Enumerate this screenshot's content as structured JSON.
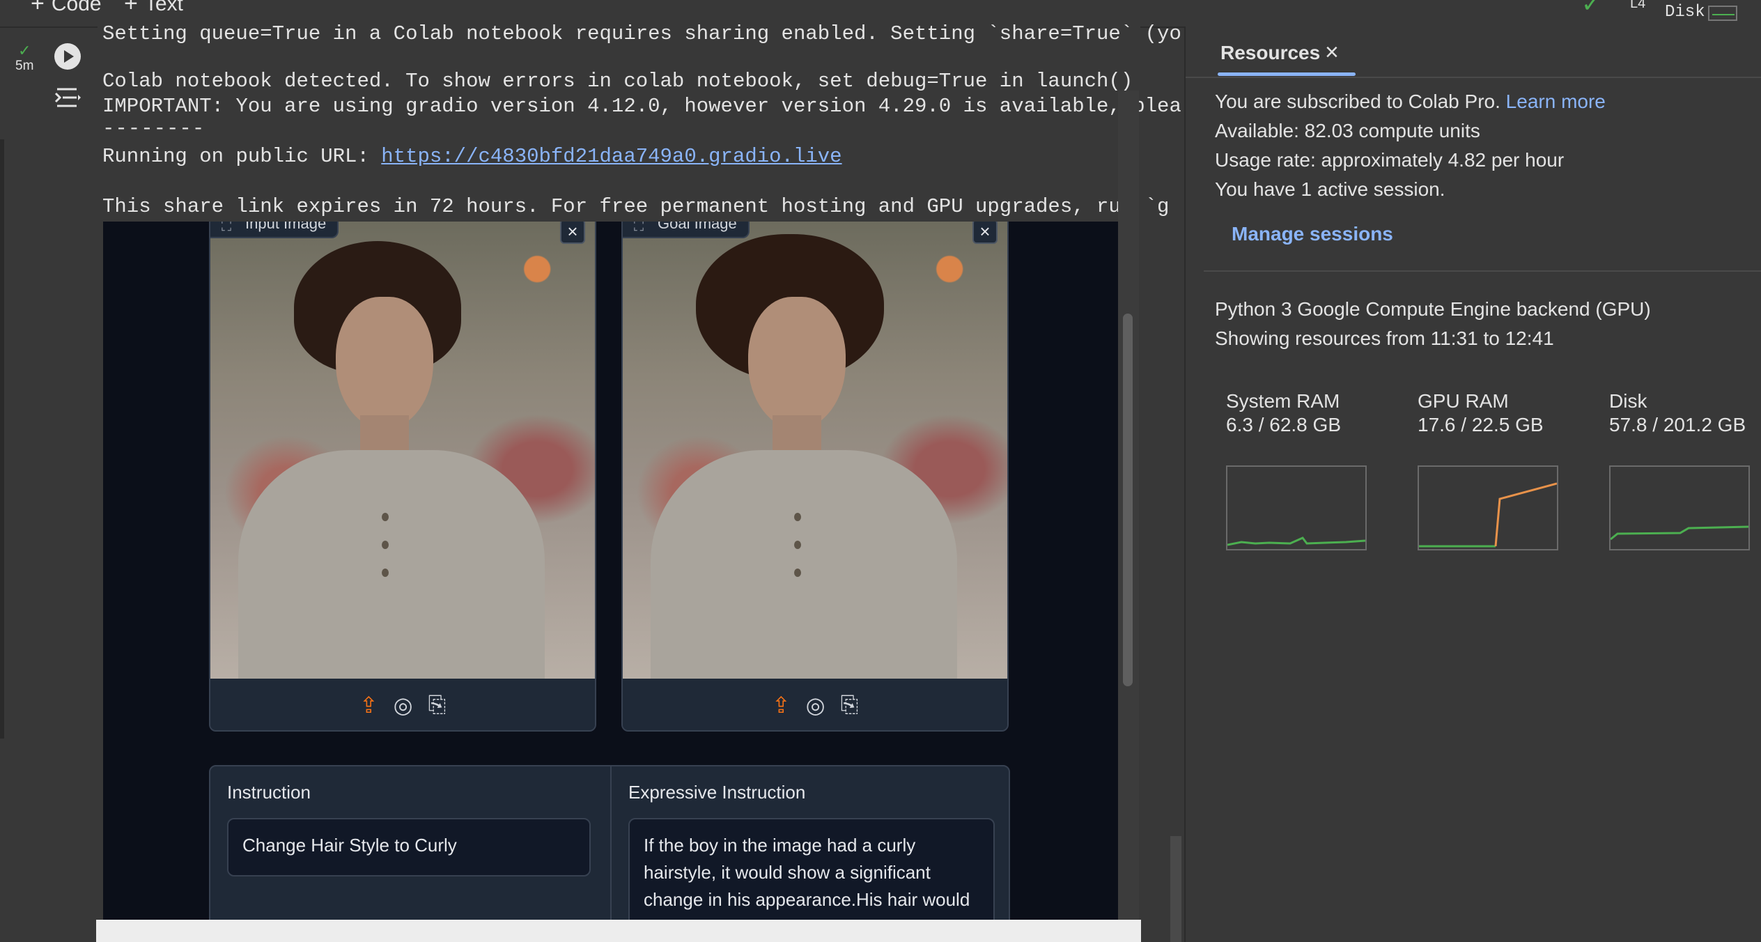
{
  "toolbar": {
    "code_label": "Code",
    "text_label": "Text",
    "runtime_label": "L4",
    "disk_label": "Disk"
  },
  "cell": {
    "exec_time": "5m",
    "output_lines": [
      "Setting queue=True in a Colab notebook requires sharing enabled. Setting `share=True` (yo",
      "",
      "Colab notebook detected. To show errors in colab notebook, set debug=True in launch()",
      "IMPORTANT: You are using gradio version 4.12.0, however version 4.29.0 is available, plea",
      "--------"
    ],
    "url_prefix": "Running on public URL: ",
    "url": "https://c4830bfd21daa749a0.gradio.live",
    "expire_line": "This share link expires in 72 hours. For free permanent hosting and GPU upgrades, run `g"
  },
  "gradio": {
    "input_image_label": "Input Image",
    "goal_image_label": "Goal Image",
    "instruction_label": "Instruction",
    "instruction_value": "Change Hair Style to Curly",
    "expressive_label": "Expressive Instruction",
    "expressive_value": "If the boy in the image had a curly hairstyle, it would show a significant change in his appearance.His hair would"
  },
  "resources": {
    "tab_label": "Resources",
    "subscribed_text": "You are subscribed to Colab Pro.",
    "learn_more": "Learn more",
    "available": "Available: 82.03 compute units",
    "usage_rate": "Usage rate: approximately 4.82 per hour",
    "active_sessions": "You have 1 active session.",
    "manage_sessions": "Manage sessions",
    "backend": "Python 3 Google Compute Engine backend (GPU)",
    "time_range": "Showing resources from 11:31 to 12:41",
    "metrics": [
      {
        "name": "System RAM",
        "value": "6.3 / 62.8 GB",
        "color": "#4caf50"
      },
      {
        "name": "GPU RAM",
        "value": "17.6 / 22.5 GB",
        "color": "#e8924a"
      },
      {
        "name": "Disk",
        "value": "57.8 / 201.2 GB",
        "color": "#4caf50"
      }
    ]
  },
  "colors": {
    "accent": "#8ab4f8",
    "success": "#4caf50",
    "gradio_bg": "#0b0f19",
    "upload_icon": "#f97316"
  }
}
